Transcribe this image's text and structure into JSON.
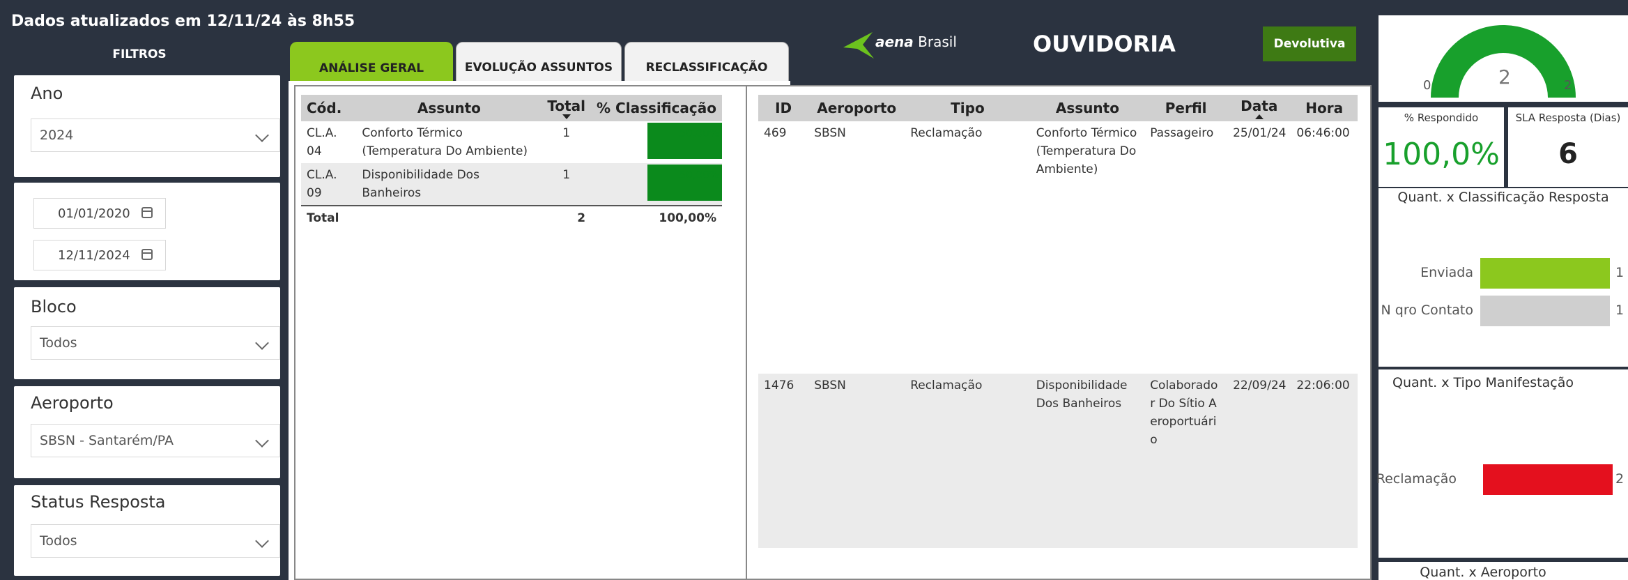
{
  "header": {
    "updated": "Dados atualizados em 12/11/24 às 8h55",
    "filters_title": "FILTROS"
  },
  "filters": {
    "ano": {
      "label": "Ano",
      "value": "2024"
    },
    "date_start": "01/01/2020",
    "date_end": "12/11/2024",
    "bloco": {
      "label": "Bloco",
      "value": "Todos"
    },
    "aeroporto": {
      "label": "Aeroporto",
      "value": "SBSN - Santarém/PA"
    },
    "status": {
      "label": "Status Resposta",
      "value": "Todos"
    }
  },
  "tabs": [
    {
      "label": "ANÁLISE GERAL"
    },
    {
      "label": "EVOLUÇÃO ASSUNTOS"
    },
    {
      "label": "RECLASSIFICAÇÃO"
    }
  ],
  "brand": {
    "logo_bold": "aena",
    "logo_light": "Brasil",
    "title": "OUVIDORIA",
    "button": "Devolutiva"
  },
  "class_table": {
    "headers": {
      "cod": "Cód.",
      "assunto": "Assunto",
      "total": "Total",
      "pct": "% Classificação"
    },
    "rows": [
      {
        "cod": "CL.A. 04",
        "assunto": "Conforto Térmico (Temperatura Do Ambiente)",
        "total": "1",
        "pct": "50,00%",
        "fraction": 0.5
      },
      {
        "cod": "CL.A. 09",
        "assunto": "Disponibilidade Dos Banheiros",
        "total": "1",
        "pct": "50,00%",
        "fraction": 0.5
      }
    ],
    "footer": {
      "label": "Total",
      "total": "2",
      "pct": "100,00%"
    }
  },
  "detail_table": {
    "headers": {
      "id": "ID",
      "aeroporto": "Aeroporto",
      "tipo": "Tipo",
      "assunto": "Assunto",
      "perfil": "Perfil",
      "data": "Data",
      "hora": "Hora"
    },
    "rows": [
      {
        "id": "469",
        "aeroporto": "SBSN",
        "tipo": "Reclamação",
        "assunto": "Conforto Térmico (Temperatura Do Ambiente)",
        "perfil": "Passageiro",
        "data": "25/01/24",
        "hora": "06:46:00"
      },
      {
        "id": "1476",
        "aeroporto": "SBSN",
        "tipo": "Reclamação",
        "assunto": "Disponibilidade Dos Banheiros",
        "perfil": "Colaborador Do Sítio Aeroportuário",
        "data": "22/09/24",
        "hora": "22:06:00"
      }
    ]
  },
  "gauge": {
    "min": "0",
    "value": "2",
    "max": "2",
    "fraction": 1.0,
    "color": "#18a02c"
  },
  "kpis": {
    "respondido_label": "% Respondido",
    "respondido_value": "100,0%",
    "sla_label": "SLA Resposta (Dias)",
    "sla_value": "6"
  },
  "chart_classificacao": {
    "title": "Quant. x Classificação Resposta",
    "bars": [
      {
        "label": "Enviada",
        "value": 1,
        "value_text": "1",
        "color": "#8cc81e"
      },
      {
        "label": "N qro Contato",
        "value": 1,
        "value_text": "1",
        "color": "#cfcfcf"
      }
    ],
    "max": 1
  },
  "chart_tipo": {
    "title": "Quant. x Tipo Manifestação",
    "bars": [
      {
        "label": "Reclamação",
        "value": 2,
        "value_text": "2",
        "color": "#e4101e"
      }
    ],
    "max": 2
  },
  "chart_aeroporto": {
    "title": "Quant. x Aeroporto"
  }
}
